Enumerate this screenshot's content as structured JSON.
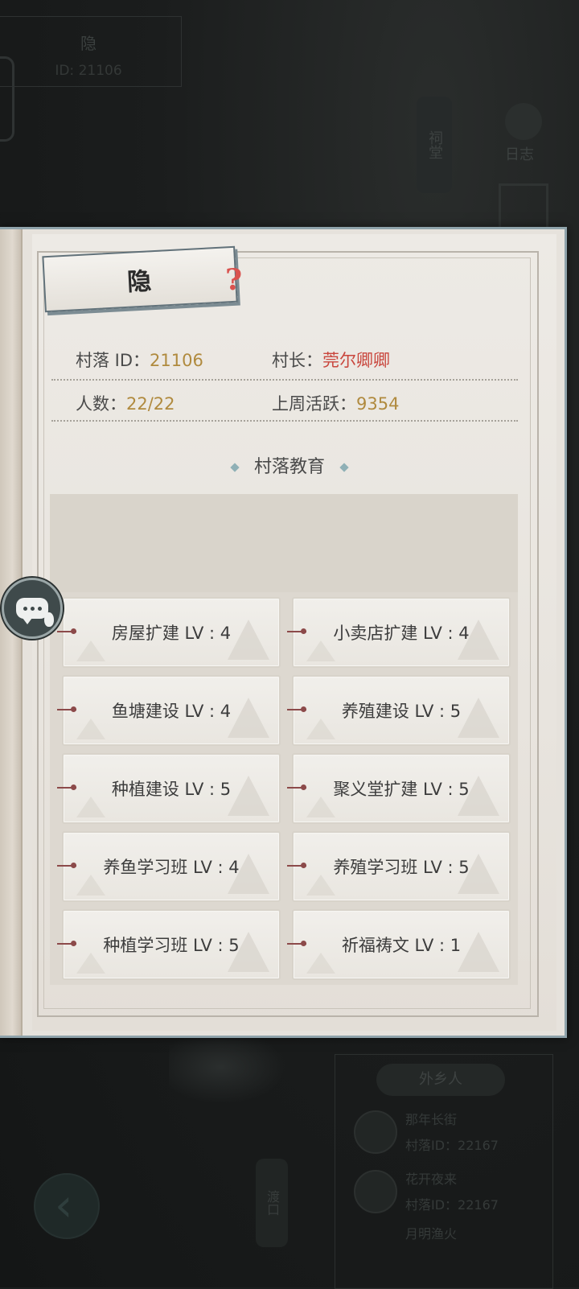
{
  "background": {
    "top_name": "隐",
    "top_id": "ID: 21106",
    "side_tag": "祠堂",
    "diary_label": "日志",
    "stranger_title": "外乡人",
    "entries": [
      {
        "name": "那年长街",
        "village_id": "村落ID：22167"
      },
      {
        "name": "花开夜来",
        "village_id": "村落ID：22167"
      },
      {
        "name": "月明渔火",
        "village_id": ""
      }
    ],
    "ferry_label": "渡口"
  },
  "panel": {
    "title": "隐",
    "help_icon": "?",
    "village_id_label": "村落  ID：",
    "village_id_value": "21106",
    "chief_label": "村长：",
    "chief_value": "莞尔卿卿",
    "population_label": "人数：",
    "population_value": "22/22",
    "activity_label": "上周活跃：",
    "activity_value": "9354",
    "section_title": "村落教育"
  },
  "education_items": [
    {
      "label": "房屋扩建 LV : 4"
    },
    {
      "label": "小卖店扩建 LV : 4"
    },
    {
      "label": "鱼塘建设 LV : 4"
    },
    {
      "label": "养殖建设 LV : 5"
    },
    {
      "label": "种植建设 LV : 5"
    },
    {
      "label": "聚义堂扩建 LV : 5"
    },
    {
      "label": "养鱼学习班 LV : 4"
    },
    {
      "label": "养殖学习班 LV : 5"
    },
    {
      "label": "种植学习班 LV : 5"
    },
    {
      "label": "祈福祷文 LV : 1"
    }
  ],
  "colors": {
    "gold_value": "#b08a3e",
    "red_value": "#c9463d",
    "frame_border": "#8fa3ab"
  }
}
